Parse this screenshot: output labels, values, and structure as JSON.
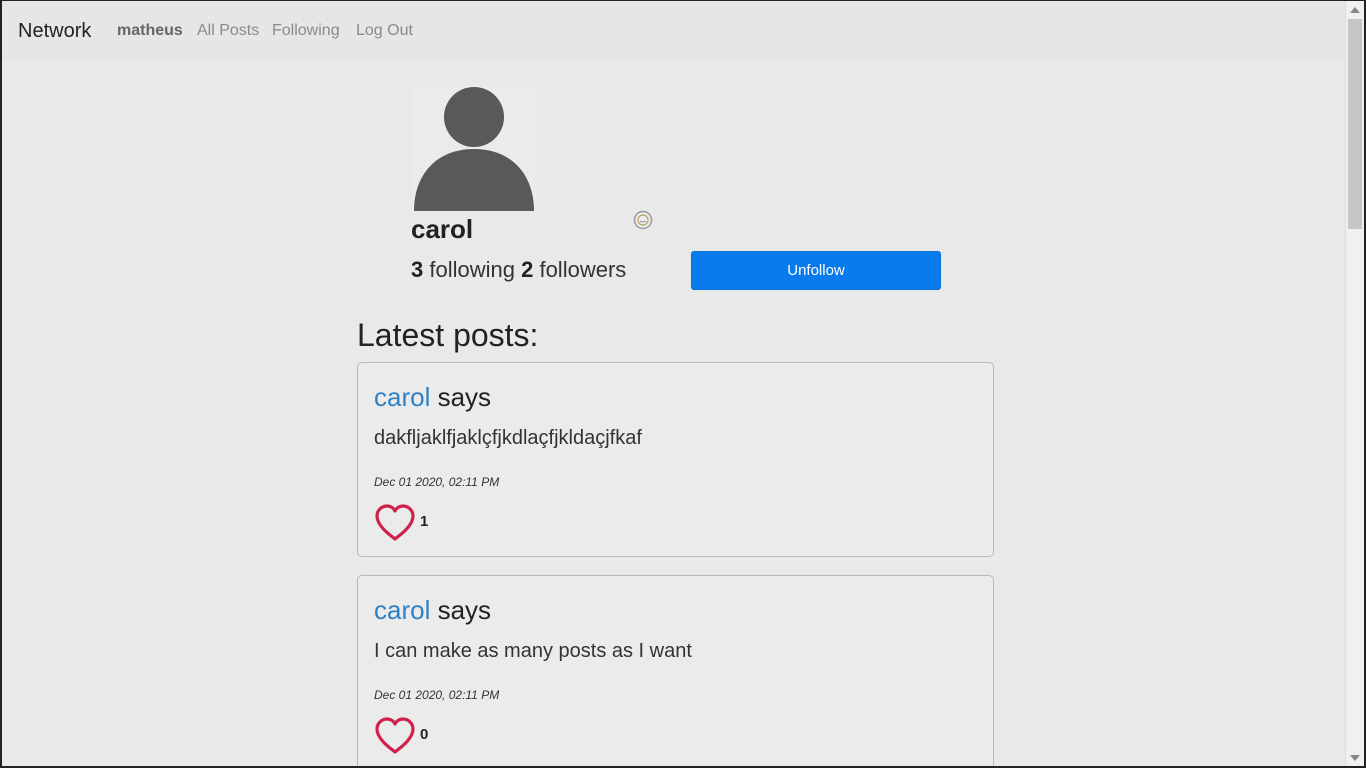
{
  "navbar": {
    "brand": "Network",
    "user": "matheus",
    "links": [
      "All Posts",
      "Following",
      "Log Out"
    ]
  },
  "profile": {
    "username": "carol",
    "following_count": "3",
    "following_label": " following ",
    "followers_count": "2",
    "followers_label": " followers",
    "unfollow_label": "Unfollow",
    "avatar_icon": "person-avatar-icon"
  },
  "latest_posts_title": "Latest posts:",
  "posts": [
    {
      "author": "carol",
      "says": " says",
      "body": "dakfljaklfjaklçfjkdlaçfjkldaçjfkaf",
      "timestamp": "Dec 01 2020, 02:11 PM",
      "likes": "1"
    },
    {
      "author": "carol",
      "says": " says",
      "body": "I can make as many posts as I want",
      "timestamp": "Dec 01 2020, 02:11 PM",
      "likes": "0"
    }
  ],
  "colors": {
    "accent": "#0a7bea",
    "author_link": "#2d82c7",
    "heart": "#d0214c"
  }
}
